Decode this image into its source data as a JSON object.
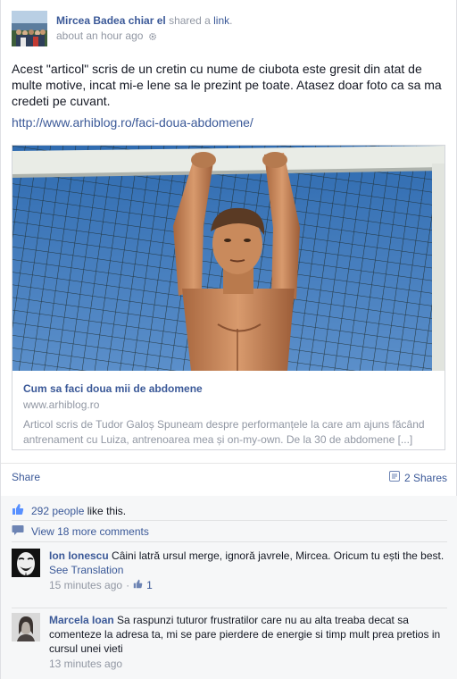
{
  "post": {
    "author": "Mircea Badea chiar el",
    "action_prefix": " shared a ",
    "action_link": "link",
    "action_suffix": ".",
    "time": "about an hour ago",
    "text": "Acest \"articol\" scris de un cretin cu nume de ciubota este gresit din atat de multe motive, incat mi-e lene sa le prezint pe toate. Atasez doar foto ca sa ma credeti pe cuvant.",
    "url": "http://www.arhiblog.ro/faci-doua-abdomene/"
  },
  "attachment": {
    "title": "Cum sa faci doua mii de abdomene",
    "domain": "www.arhiblog.ro",
    "description": "Articol scris de Tudor Galoș Spuneam despre performanțele la care am ajuns făcând antrenament cu Luiza, antrenoarea mea și on-my-own. De la 30 de abdomene [...]"
  },
  "actions": {
    "share_label": "Share",
    "shares_count": "2 Shares"
  },
  "ufi": {
    "likes_count": "292 people",
    "likes_suffix": " like this.",
    "more_comments": "View 18 more comments"
  },
  "comments": [
    {
      "name": "Ion Ionescu",
      "text": "Câini latră ursul merge, ignoră javrele, Mircea. Oricum tu ești the best.",
      "see_translation": "See Translation",
      "time": "15 minutes ago",
      "likes": "1"
    },
    {
      "name": "Marcela Ioan",
      "text": "Sa raspunzi tuturor frustratilor care nu au alta treaba decat sa comenteze la adresa ta, mi se pare pierdere de energie si timp mult prea pretios in cursul unei vieti",
      "time": "13 minutes ago"
    }
  ],
  "colors": {
    "link": "#3b5998",
    "muted": "#9197a3",
    "ufi_bg": "#f6f7f8"
  },
  "icons": [
    "privacy-gear-icon",
    "share-list-icon",
    "like-thumb-icon",
    "comment-bubble-icon",
    "comment-like-icon"
  ]
}
